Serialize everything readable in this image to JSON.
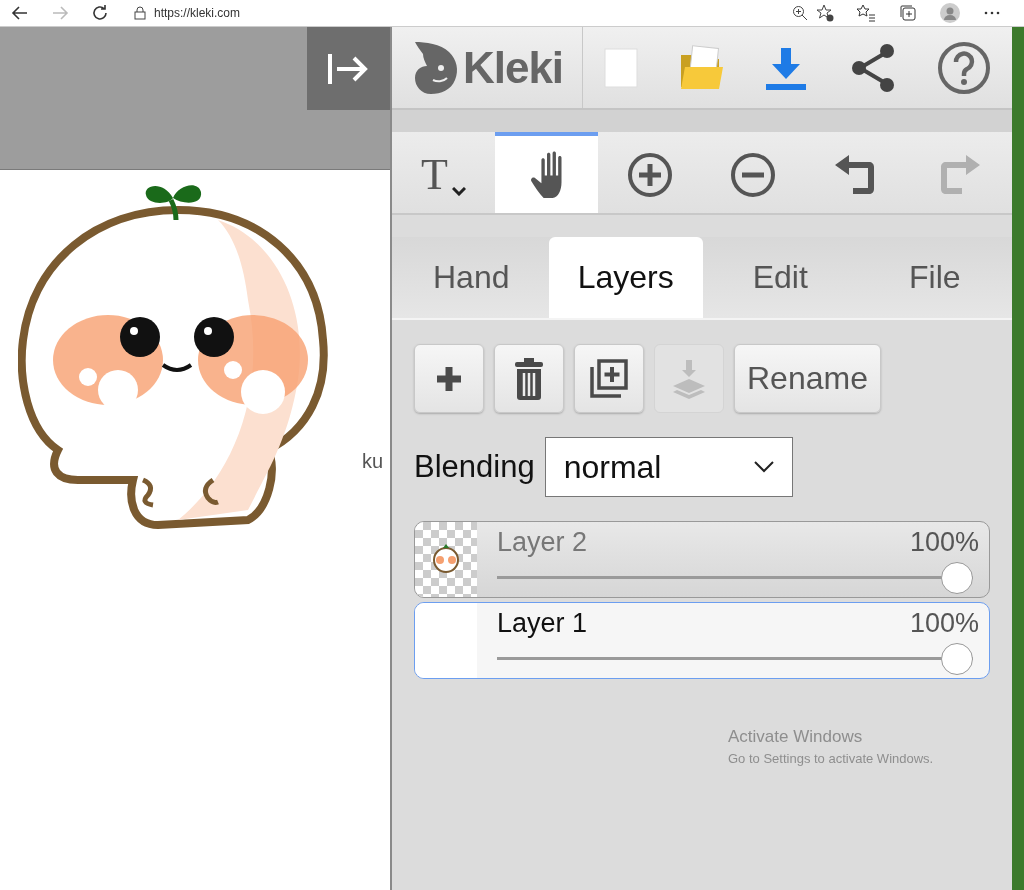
{
  "browser": {
    "url": "https://kleki.com"
  },
  "canvas": {
    "side_text": "ku"
  },
  "logo": {
    "text": "Kleki"
  },
  "tools": [
    {
      "kind": "text",
      "glyph": "T",
      "selected": false,
      "disabled": false
    },
    {
      "kind": "hand",
      "selected": true,
      "disabled": false
    },
    {
      "kind": "zoom-in",
      "selected": false,
      "disabled": false
    },
    {
      "kind": "zoom-out",
      "selected": false,
      "disabled": false
    },
    {
      "kind": "undo",
      "selected": false,
      "disabled": false
    },
    {
      "kind": "redo",
      "selected": false,
      "disabled": true
    }
  ],
  "tabs": [
    {
      "label": "Hand",
      "selected": false
    },
    {
      "label": "Layers",
      "selected": true
    },
    {
      "label": "Edit",
      "selected": false
    },
    {
      "label": "File",
      "selected": false
    }
  ],
  "layer_actions": [
    {
      "kind": "add",
      "disabled": false
    },
    {
      "kind": "delete",
      "disabled": false
    },
    {
      "kind": "duplicate",
      "disabled": false
    },
    {
      "kind": "merge",
      "disabled": true
    },
    {
      "kind": "rename",
      "label": "Rename",
      "disabled": false
    }
  ],
  "blending": {
    "label": "Blending",
    "value": "normal"
  },
  "layers": [
    {
      "name": "Layer 2",
      "opacity": "100%",
      "level": 1,
      "selected": false,
      "checkerboard": true
    },
    {
      "name": "Layer 1",
      "opacity": "100%",
      "level": 1,
      "selected": true,
      "checkerboard": false
    }
  ],
  "notice": {
    "title": "Activate Windows",
    "subtitle": "Go to Settings to activate Windows."
  }
}
